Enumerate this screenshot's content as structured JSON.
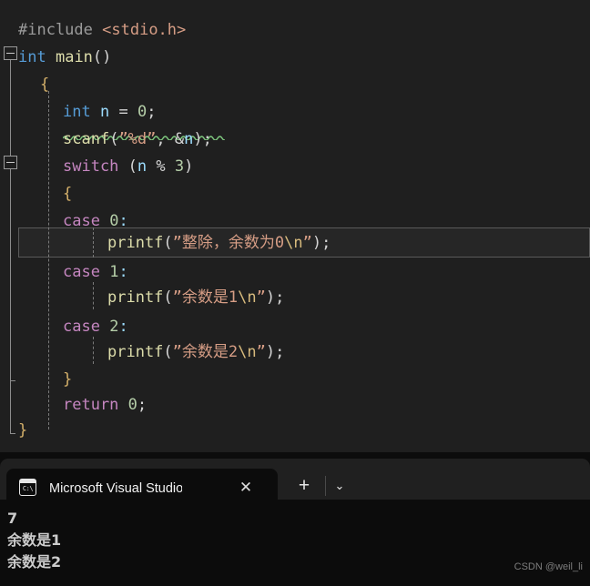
{
  "editor": {
    "language": "c",
    "background": "#1f1f1f",
    "highlighted_line_index": 8,
    "lines": [
      {
        "indent": 0,
        "text": "#include <stdio.h>"
      },
      {
        "indent": 0,
        "text": "int main()"
      },
      {
        "indent": 1,
        "text": "{"
      },
      {
        "indent": 2,
        "text": "int n = 0;"
      },
      {
        "indent": 2,
        "text": "scanf(\"%d\", &n);"
      },
      {
        "indent": 2,
        "text": "switch (n % 3)"
      },
      {
        "indent": 2,
        "text": "{"
      },
      {
        "indent": 2,
        "text": "case 0:"
      },
      {
        "indent": 3,
        "text": "printf(\"整除，余数为0\\n\");"
      },
      {
        "indent": 2,
        "text": "case 1:"
      },
      {
        "indent": 3,
        "text": "printf(\"余数是1\\n\");"
      },
      {
        "indent": 2,
        "text": "case 2:"
      },
      {
        "indent": 3,
        "text": "printf(\"余数是2\\n\");"
      },
      {
        "indent": 2,
        "text": "}"
      },
      {
        "indent": 2,
        "text": "return 0;"
      },
      {
        "indent": 1,
        "text": "}"
      }
    ],
    "fold_markers": [
      {
        "label": "-",
        "line": 1,
        "expanded": true
      },
      {
        "label": "-",
        "line": 5,
        "expanded": true
      }
    ],
    "error_squiggle_line": "scanf(\"%d\", &n);"
  },
  "terminal": {
    "tab": {
      "title": "Microsoft Visual Studio 调试控",
      "icon": "console-icon",
      "icon_glyph": "C:\\",
      "close_label": "✕"
    },
    "new_tab_label": "+",
    "tab_menu_label": "⌄",
    "output": [
      "7",
      "余数是1",
      "余数是2"
    ]
  },
  "watermark": {
    "text": "CSDN @weil_li"
  },
  "colors": {
    "editor_bg": "#1f1f1f",
    "terminal_bg": "#0c0c0c",
    "titlebar_bg": "#202020",
    "keyword": "#569cd6",
    "control_keyword": "#c586c0",
    "function": "#dcdcaa",
    "variable": "#9cdcfe",
    "number": "#b5cea8",
    "string": "#d69d85",
    "escape": "#d7ba7d",
    "preprocessor": "#9b9b9b",
    "brace": "#d4b06a",
    "squiggle": "#7ec87e"
  }
}
